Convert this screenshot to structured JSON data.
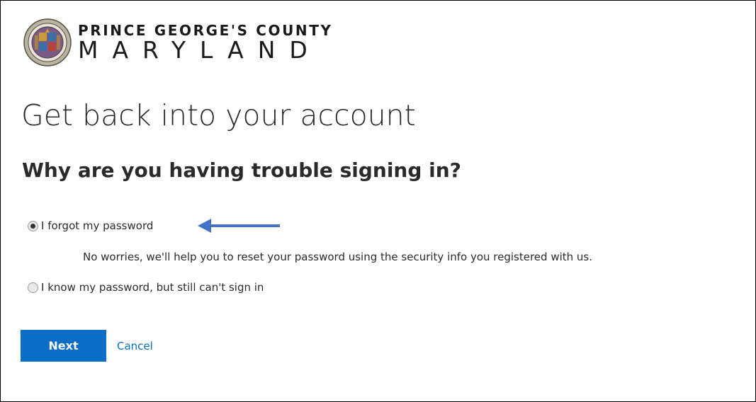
{
  "brand": {
    "line1": "PRINCE GEORGE'S COUNTY",
    "line2": "MARYLAND",
    "seal_icon": "county-seal-icon"
  },
  "page": {
    "title": "Get back into your account",
    "subtitle": "Why are you having trouble signing in?"
  },
  "options": [
    {
      "label": "I forgot my password",
      "selected": true,
      "description": "No worries, we'll help you to reset your password using the security info you registered with us."
    },
    {
      "label": "I know my password, but still can't sign in",
      "selected": false
    }
  ],
  "annotation": {
    "icon": "arrow-left-icon",
    "color": "#4472c4"
  },
  "actions": {
    "next_label": "Next",
    "cancel_label": "Cancel"
  },
  "colors": {
    "accent": "#0a6ec7",
    "text": "#2b2b2b"
  }
}
